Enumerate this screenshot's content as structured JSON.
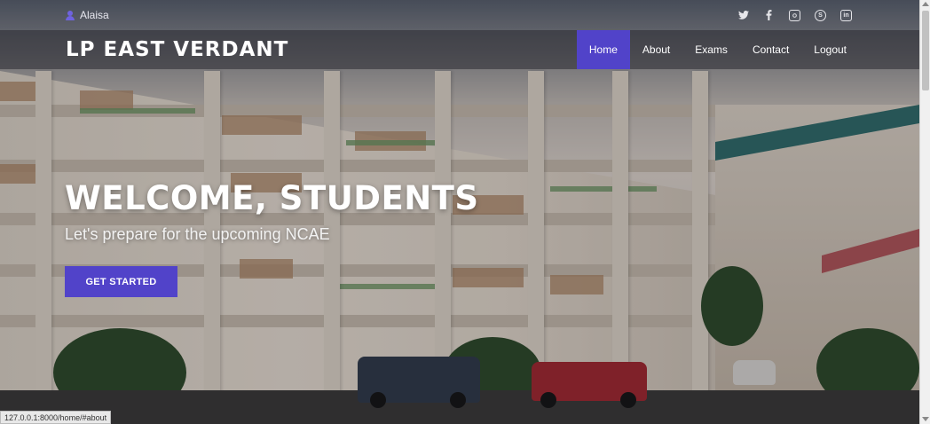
{
  "topbar": {
    "username": "Alaisa",
    "social_icons": [
      "twitter-icon",
      "facebook-icon",
      "instagram-icon",
      "skype-icon",
      "linkedin-icon"
    ]
  },
  "navbar": {
    "brand": "LP EAST VERDANT",
    "links": [
      "Home",
      "About",
      "Exams",
      "Contact",
      "Logout"
    ],
    "active_link": "Home"
  },
  "hero": {
    "title": "WELCOME, STUDENTS",
    "subtitle": "Let's prepare for the upcoming NCAE",
    "cta_label": "GET STARTED"
  },
  "status_bar": {
    "url": "127.0.0.1:8000/home/#about"
  },
  "colors": {
    "accent": "#5143c9",
    "text_light": "#ffffff"
  }
}
